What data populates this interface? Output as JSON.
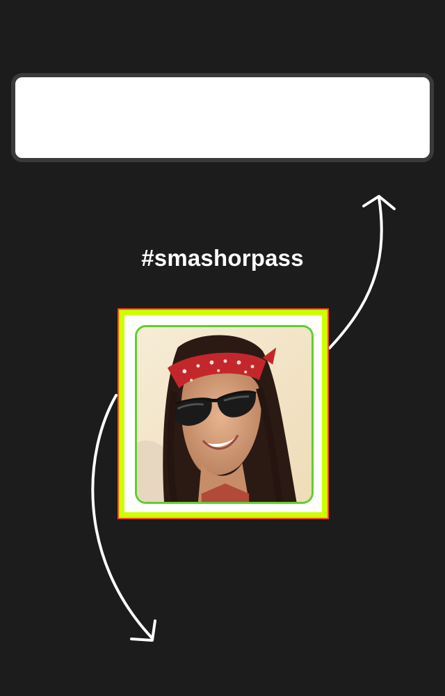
{
  "hashtag": "#smashorpass",
  "banner": {
    "text": ""
  },
  "photo": {
    "icon": "profile-photo",
    "description_icons": [
      "bandana",
      "sunglasses"
    ]
  },
  "colors": {
    "background": "#1c1c1c",
    "banner_bg": "#ffffff",
    "banner_border": "#3a3a3a",
    "card_outer": "#ccff00",
    "card_border": "#ff4a1c",
    "photo_border": "#5fd02a",
    "arrow": "#ffffff",
    "text": "#ffffff"
  }
}
